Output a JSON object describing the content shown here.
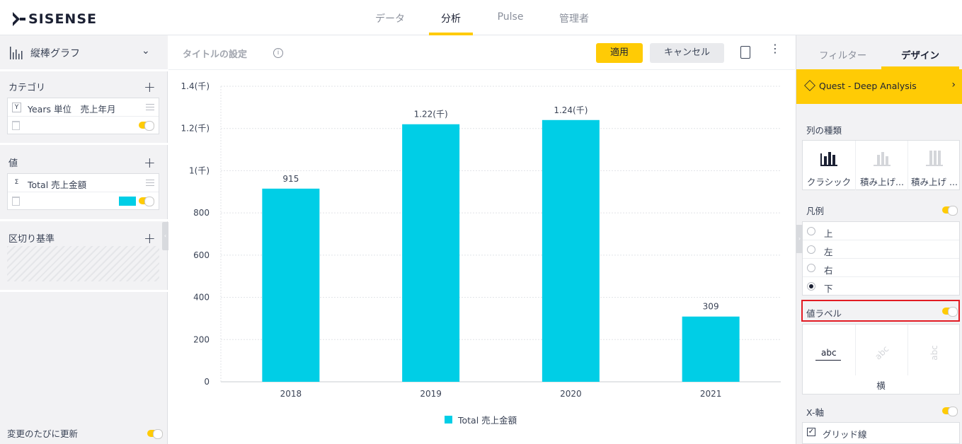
{
  "app": {
    "logo_text": "SISENSE",
    "nav_tabs": [
      "データ",
      "分析",
      "Pulse",
      "管理者"
    ],
    "active_tab": "分析"
  },
  "left_panel": {
    "widget_type": "縦棒グラフ",
    "categories_title": "カテゴリ",
    "category_field": {
      "chip": "Y",
      "label": "Years 単位　売上年月"
    },
    "values_title": "値",
    "value_field": {
      "chip": "Σ",
      "label": "Total 売上金額",
      "color": "#00cee6"
    },
    "breakby_title": "区切り基準",
    "auto_update_label": "変更のたびに更新"
  },
  "toolbar": {
    "title_placeholder": "タイトルの設定",
    "apply_label": "適用",
    "cancel_label": "キャンセル"
  },
  "chart_data": {
    "type": "bar",
    "categories": [
      "2018",
      "2019",
      "2020",
      "2021"
    ],
    "series": [
      {
        "name": "Total 売上金額",
        "values": [
          915,
          1220,
          1240,
          309
        ],
        "color": "#00cee6"
      }
    ],
    "data_labels": [
      "915",
      "1.22(千)",
      "1.24(千)",
      "309"
    ],
    "y_ticks": [
      "0",
      "200",
      "400",
      "600",
      "800",
      "1(千)",
      "1.2(千)",
      "1.4(千)"
    ],
    "ylim": [
      0,
      1400
    ],
    "grid": true,
    "legend_position": "bottom"
  },
  "right_panel": {
    "tabs": [
      "フィルター",
      "デザイン"
    ],
    "active_tab": "デザイン",
    "data_model": "Quest - Deep Analysis",
    "column_type_title": "列の種類",
    "column_types": [
      "クラシック",
      "積み上げ...",
      "積み上げ ..."
    ],
    "legend_title": "凡例",
    "legend_options": [
      {
        "label": "上",
        "checked": false
      },
      {
        "label": "左",
        "checked": false
      },
      {
        "label": "右",
        "checked": false
      },
      {
        "label": "下",
        "checked": true
      }
    ],
    "value_label_title": "値ラベル",
    "value_label_sample": "abc",
    "value_label_orientation": "横",
    "x_axis_title": "X-軸",
    "grid_lines_label": "グリッド線"
  }
}
